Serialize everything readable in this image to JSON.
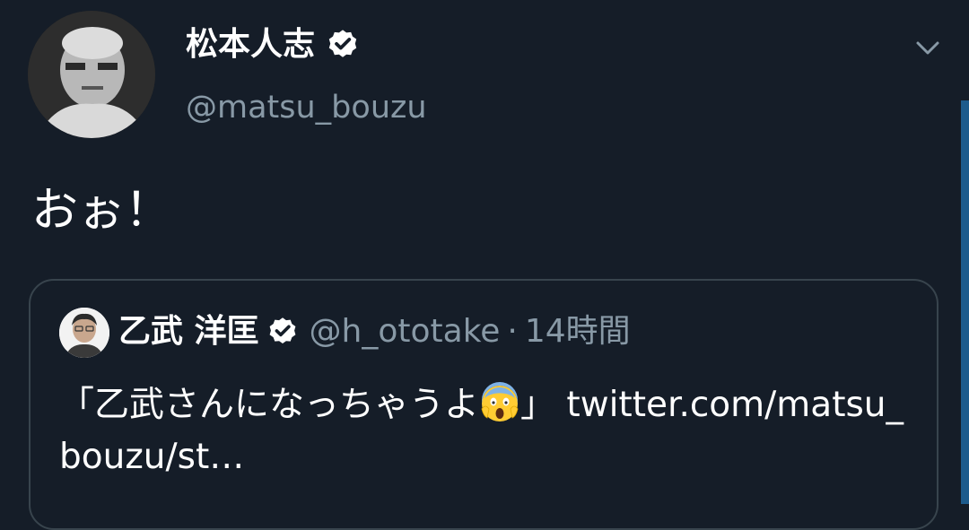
{
  "tweet": {
    "display_name": "松本人志",
    "handle": "@matsu_bouzu",
    "text": "おぉ！",
    "icons": [
      "avatar-photo",
      "verified-badge-icon",
      "chevron-down-icon"
    ]
  },
  "quoted_tweet": {
    "display_name": "乙武 洋匡",
    "handle": "@h_ototake",
    "separator": "·",
    "time": "14時間",
    "text_before_emoji": "「乙武さんになっちゃうよ",
    "emoji": "😱",
    "text_after_emoji": "」 twitter.com/matsu_bouzu/st…",
    "icons": [
      "avatar-photo",
      "verified-badge-icon",
      "screaming-face-emoji"
    ]
  },
  "colors": {
    "background": "#151d28",
    "text_primary": "#ffffff",
    "text_secondary": "#8899a6",
    "border": "#38444d",
    "scrollbar": "#1d5b8c"
  }
}
